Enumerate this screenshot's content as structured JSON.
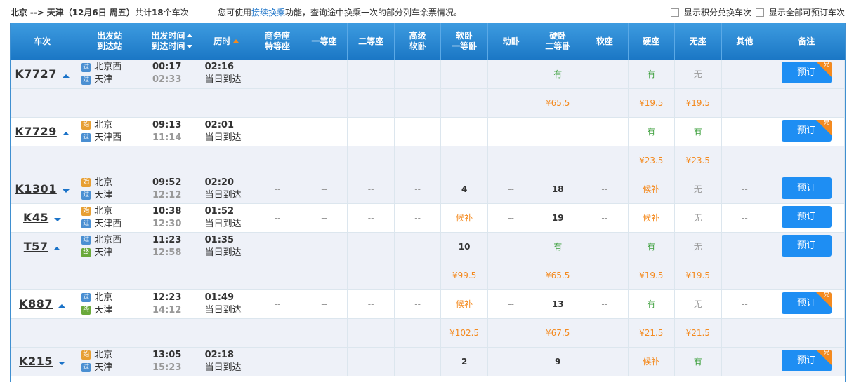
{
  "route": {
    "from": "北京",
    "arrow": "-->",
    "to": "天津",
    "date": "（12月6日 周五）",
    "count_prefix": "共计",
    "count": "18",
    "count_suffix": "个车次"
  },
  "notice": {
    "before": "您可使用",
    "link": "接续换乘",
    "after": "功能，查询途中换乘一次的部分列车余票情况。"
  },
  "options": {
    "points": "显示积分兑换车次",
    "bookable": "显示全部可预订车次"
  },
  "headers": {
    "train": "车次",
    "stations_1": "出发站",
    "stations_2": "到达站",
    "time_1": "出发时间",
    "time_2": "到达时间",
    "duration": "历时",
    "biz_1": "商务座",
    "biz_2": "特等座",
    "first": "一等座",
    "second": "二等座",
    "gsoft_1": "高级",
    "gsoft_2": "软卧",
    "soft_1": "软卧",
    "soft_2": "一等卧",
    "dw": "动卧",
    "hard_1": "硬卧",
    "hard_2": "二等卧",
    "softseat": "软座",
    "hardseat": "硬座",
    "noseat": "无座",
    "other": "其他",
    "remark": "备注"
  },
  "icons": {
    "start": "始",
    "pass": "过",
    "end": "终"
  },
  "book_label": "预订",
  "dui_label": "兑",
  "trains": [
    {
      "no": "K7727",
      "dir": "up",
      "from": "北京西",
      "from_type": "pass",
      "to": "天津",
      "to_type": "pass",
      "dep": "00:17",
      "arr": "02:33",
      "dur": "02:16",
      "day": "当日到达",
      "seats": [
        "--",
        "--",
        "--",
        "--",
        "--",
        "--",
        "有",
        "--",
        "有",
        "无",
        "--"
      ],
      "dui": true,
      "prices": [
        "",
        "",
        "",
        "",
        "",
        "",
        "¥65.5",
        "",
        "¥19.5",
        "¥19.5",
        ""
      ]
    },
    {
      "no": "K7729",
      "dir": "up",
      "from": "北京",
      "from_type": "start",
      "to": "天津西",
      "to_type": "pass",
      "dep": "09:13",
      "arr": "11:14",
      "dur": "02:01",
      "day": "当日到达",
      "seats": [
        "--",
        "--",
        "--",
        "--",
        "--",
        "--",
        "--",
        "--",
        "有",
        "有",
        "--"
      ],
      "dui": true,
      "prices": [
        "",
        "",
        "",
        "",
        "",
        "",
        "",
        "",
        "¥23.5",
        "¥23.5",
        ""
      ]
    },
    {
      "no": "K1301",
      "dir": "down",
      "from": "北京",
      "from_type": "start",
      "to": "天津",
      "to_type": "pass",
      "dep": "09:52",
      "arr": "12:12",
      "dur": "02:20",
      "day": "当日到达",
      "seats": [
        "--",
        "--",
        "--",
        "--",
        "4",
        "--",
        "18",
        "--",
        "候补",
        "无",
        "--"
      ],
      "dui": false,
      "prices": null
    },
    {
      "no": "K45",
      "dir": "down",
      "from": "北京",
      "from_type": "start",
      "to": "天津西",
      "to_type": "pass",
      "dep": "10:38",
      "arr": "12:30",
      "dur": "01:52",
      "day": "当日到达",
      "seats": [
        "--",
        "--",
        "--",
        "--",
        "候补",
        "--",
        "19",
        "--",
        "候补",
        "无",
        "--"
      ],
      "dui": false,
      "prices": null
    },
    {
      "no": "T57",
      "dir": "up",
      "from": "北京西",
      "from_type": "pass",
      "to": "天津",
      "to_type": "end",
      "dep": "11:23",
      "arr": "12:58",
      "dur": "01:35",
      "day": "当日到达",
      "seats": [
        "--",
        "--",
        "--",
        "--",
        "10",
        "--",
        "有",
        "--",
        "有",
        "无",
        "--"
      ],
      "dui": false,
      "prices": [
        "",
        "",
        "",
        "",
        "¥99.5",
        "",
        "¥65.5",
        "",
        "¥19.5",
        "¥19.5",
        ""
      ]
    },
    {
      "no": "K887",
      "dir": "up",
      "from": "北京",
      "from_type": "pass",
      "to": "天津",
      "to_type": "end",
      "dep": "12:23",
      "arr": "14:12",
      "dur": "01:49",
      "day": "当日到达",
      "seats": [
        "--",
        "--",
        "--",
        "--",
        "候补",
        "--",
        "13",
        "--",
        "有",
        "无",
        "--"
      ],
      "dui": true,
      "prices": [
        "",
        "",
        "",
        "",
        "¥102.5",
        "",
        "¥67.5",
        "",
        "¥21.5",
        "¥21.5",
        ""
      ]
    },
    {
      "no": "K215",
      "dir": "down",
      "from": "北京",
      "from_type": "start",
      "to": "天津",
      "to_type": "pass",
      "dep": "13:05",
      "arr": "15:23",
      "dur": "02:18",
      "day": "当日到达",
      "seats": [
        "--",
        "--",
        "--",
        "--",
        "2",
        "--",
        "9",
        "--",
        "候补",
        "有",
        "--"
      ],
      "dui": true,
      "prices": null
    }
  ]
}
